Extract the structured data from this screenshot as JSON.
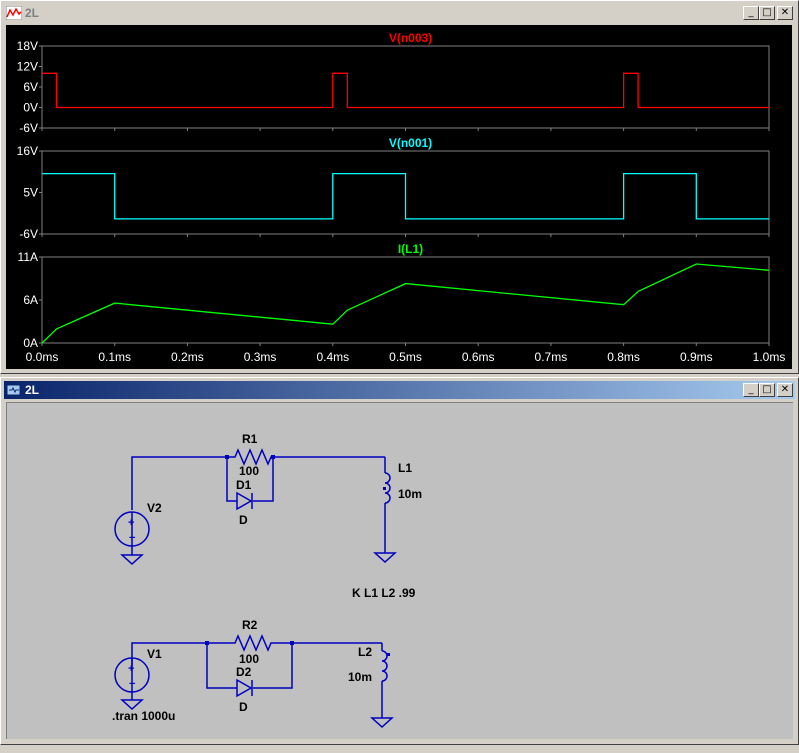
{
  "waveform_window": {
    "title": "2L",
    "controls": {
      "minimize": "_",
      "maximize": "□",
      "close": "✕"
    },
    "icon": "waveform-icon"
  },
  "schematic_window": {
    "title": "2L",
    "controls": {
      "minimize": "_",
      "maximize": "□",
      "close": "✕"
    },
    "icon": "schematic-icon"
  },
  "colors": {
    "n003": "#ff0000",
    "n001": "#00ffff",
    "il1": "#00ff00",
    "wire": "#0000c0",
    "grid": "#808080"
  },
  "plots": [
    {
      "title": "V(n003)",
      "y_ticks": [
        "18V",
        "12V",
        "6V",
        "0V",
        "-6V"
      ]
    },
    {
      "title": "V(n001)",
      "y_ticks": [
        "16V",
        "5V",
        "-6V"
      ]
    },
    {
      "title": "I(L1)",
      "y_ticks": [
        "11A",
        "6A",
        "0A"
      ]
    }
  ],
  "x_ticks": [
    "0.0ms",
    "0.1ms",
    "0.2ms",
    "0.3ms",
    "0.4ms",
    "0.5ms",
    "0.6ms",
    "0.7ms",
    "0.8ms",
    "0.9ms",
    "1.0ms"
  ],
  "chart_data": [
    {
      "type": "line",
      "title": "V(n003)",
      "ylim": [
        -6,
        18
      ],
      "xlim": [
        0,
        1.0
      ],
      "series": [
        {
          "name": "V(n003)",
          "x": [
            0,
            0.02,
            0.02,
            0.4,
            0.4,
            0.42,
            0.42,
            0.8,
            0.8,
            0.82,
            0.82,
            1.0
          ],
          "y": [
            10,
            10,
            0,
            0,
            10,
            10,
            0,
            0,
            10,
            10,
            0,
            0
          ]
        }
      ]
    },
    {
      "type": "line",
      "title": "V(n001)",
      "ylim": [
        -6,
        16
      ],
      "xlim": [
        0,
        1.0
      ],
      "series": [
        {
          "name": "V(n001)",
          "x": [
            0,
            0.1,
            0.1,
            0.4,
            0.4,
            0.5,
            0.5,
            0.8,
            0.8,
            0.9,
            0.9,
            1.0
          ],
          "y": [
            10,
            10,
            -2,
            -2,
            10,
            10,
            -2,
            -2,
            10,
            10,
            -2,
            -2
          ]
        }
      ]
    },
    {
      "type": "line",
      "title": "I(L1)",
      "ylim": [
        0,
        11
      ],
      "xlim": [
        0,
        1.0
      ],
      "series": [
        {
          "name": "I(L1)",
          "x": [
            0,
            0.02,
            0.1,
            0.4,
            0.42,
            0.5,
            0.8,
            0.82,
            0.9,
            1.0
          ],
          "y": [
            0,
            1.8,
            5.1,
            2.4,
            4.2,
            7.6,
            4.9,
            6.6,
            10.1,
            9.3
          ]
        }
      ]
    }
  ],
  "schematic": {
    "labels": {
      "r1": "R1",
      "r1_val": "100",
      "d1": "D1",
      "d1_model": "D",
      "v2": "V2",
      "l1": "L1",
      "l1_val": "10m",
      "coupling": "K L1 L2 .99",
      "r2": "R2",
      "r2_val": "100",
      "d2": "D2",
      "d2_model": "D",
      "v1": "V1",
      "l2": "L2",
      "l2_val": "10m",
      "tran": ".tran 1000u"
    }
  }
}
